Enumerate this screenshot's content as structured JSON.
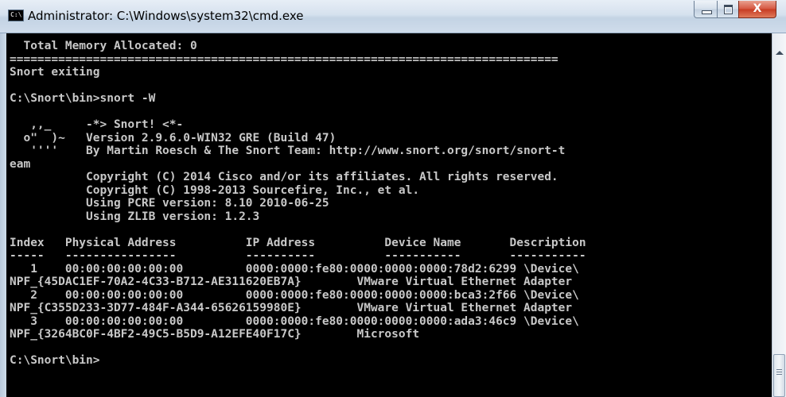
{
  "window": {
    "title": "Administrator: C:\\Windows\\system32\\cmd.exe",
    "app_icon_glyph": "C:\\",
    "close_label": "X"
  },
  "console": {
    "lines": [
      "  Total Memory Allocated: 0",
      "===============================================================================",
      "Snort exiting",
      "",
      "C:\\Snort\\bin>snort -W",
      "",
      "   ,,_     -*> Snort! <*-",
      "  o\"  )~   Version 2.9.6.0-WIN32 GRE (Build 47)",
      "   ''''    By Martin Roesch & The Snort Team: http://www.snort.org/snort/snort-t",
      "eam",
      "           Copyright (C) 2014 Cisco and/or its affiliates. All rights reserved.",
      "           Copyright (C) 1998-2013 Sourcefire, Inc., et al.",
      "           Using PCRE version: 8.10 2010-06-25",
      "           Using ZLIB version: 1.2.3",
      "",
      "Index   Physical Address          IP Address          Device Name       Description",
      "-----   ----------------          ----------          -----------       -----------",
      "   1    00:00:00:00:00:00         0000:0000:fe80:0000:0000:0000:78d2:6299 \\Device\\",
      "NPF_{45DAC1EF-70A2-4C33-B712-AE311620EB7A}        VMware Virtual Ethernet Adapter",
      "   2    00:00:00:00:00:00         0000:0000:fe80:0000:0000:0000:bca3:2f66 \\Device\\",
      "NPF_{C355D233-3D77-484F-A344-65626159980E}        VMware Virtual Ethernet Adapter",
      "   3    00:00:00:00:00:00         0000:0000:fe80:0000:0000:0000:ada3:46c9 \\Device\\",
      "NPF_{3264BC0F-4BF2-49C5-B5D9-A12EFE40F17C}        Microsoft",
      "",
      "C:\\Snort\\bin>"
    ]
  },
  "colors": {
    "console_bg": "#000000",
    "console_fg": "#c8c8c8",
    "close_button": "#c63b22"
  },
  "icons": [
    "cmd-app-icon",
    "minimize-icon",
    "maximize-icon",
    "close-icon",
    "scroll-up-arrow-icon"
  ]
}
